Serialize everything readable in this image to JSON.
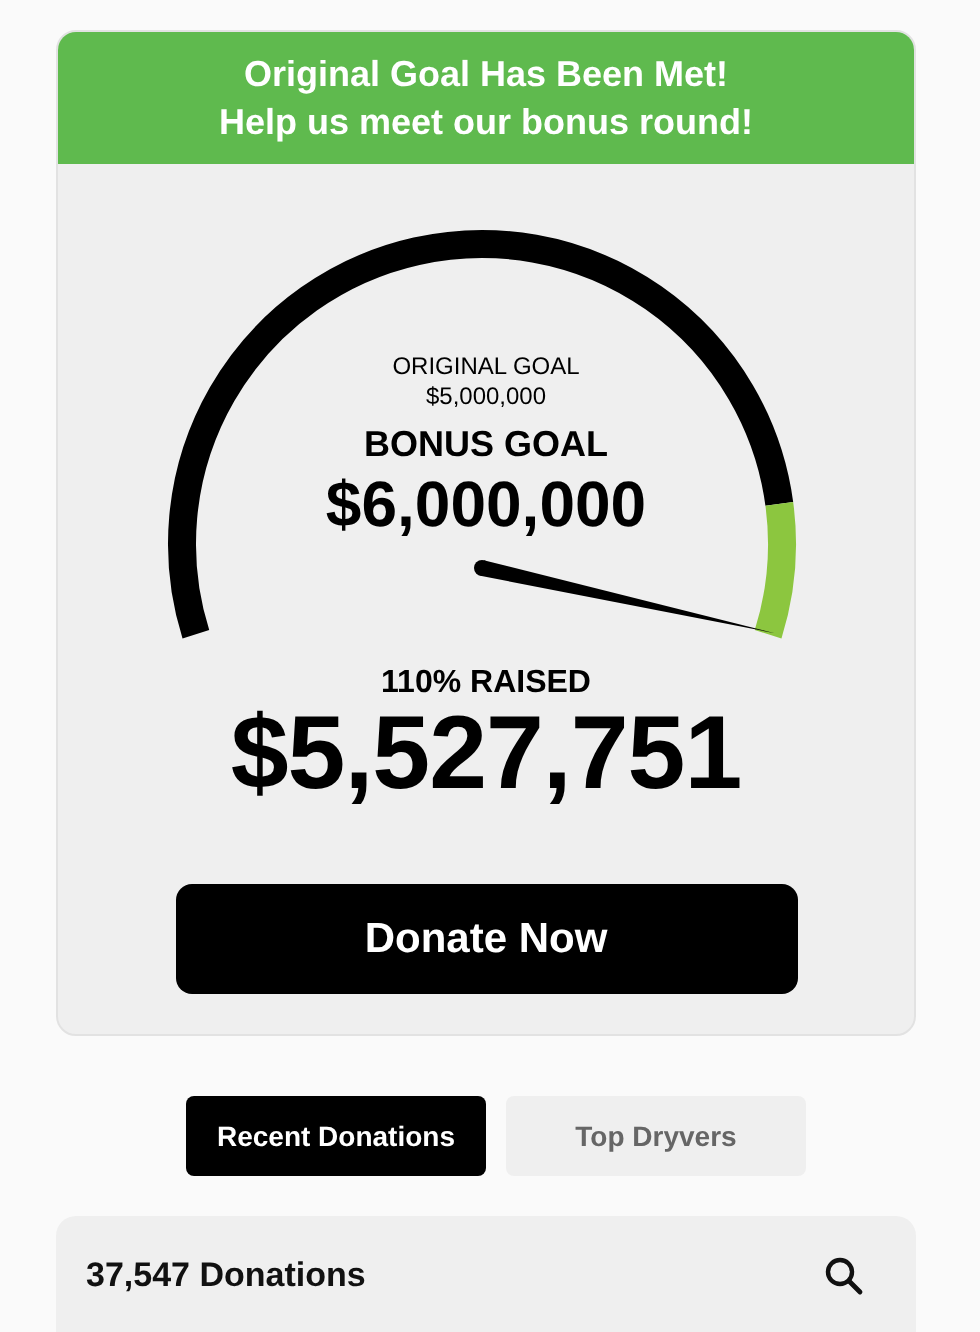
{
  "banner": {
    "lines": [
      "Original Goal Has Been Met!",
      "Help us meet our bonus round!"
    ]
  },
  "gauge": {
    "original_goal_label": "ORIGINAL GOAL",
    "original_goal": "$5,000,000",
    "bonus_goal_label": "BONUS GOAL",
    "bonus_goal": "$6,000,000",
    "raised_label": "110% RAISED",
    "raised": "$5,527,751"
  },
  "donate_button": "Donate Now",
  "tabs": [
    {
      "label": "Recent Donations",
      "selected": true
    },
    {
      "label": "Top Dryvers",
      "selected": false
    }
  ],
  "donations": {
    "count": "37,547 Donations"
  }
}
